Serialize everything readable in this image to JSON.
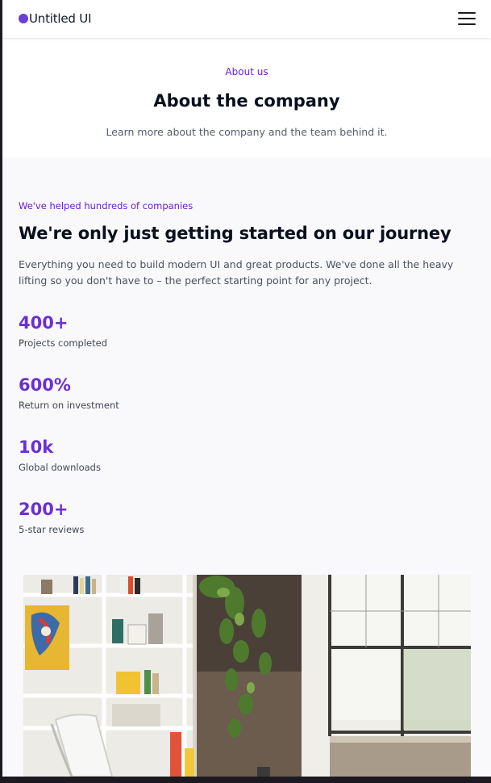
{
  "brand": {
    "name": "Untitled UI",
    "accent_color": "#6b3fd0"
  },
  "nav": {
    "menu_icon": "hamburger-menu-icon"
  },
  "hero": {
    "eyebrow": "About us",
    "title": "About the company",
    "subtitle": "Learn more about the company and the team behind it."
  },
  "section": {
    "eyebrow": "We've helped hundreds of companies",
    "title": "We're only just getting started on our journey",
    "description": "Everything you need to build modern UI and great products. We've done all the heavy lifting so you don't have to – the perfect starting point for any project."
  },
  "stats": [
    {
      "value": "400+",
      "label": "Projects completed"
    },
    {
      "value": "600%",
      "label": "Return on investment"
    },
    {
      "value": "10k",
      "label": "Global downloads"
    },
    {
      "value": "200+",
      "label": "5-star reviews"
    }
  ],
  "image": {
    "subject": "office-interior-photo"
  }
}
